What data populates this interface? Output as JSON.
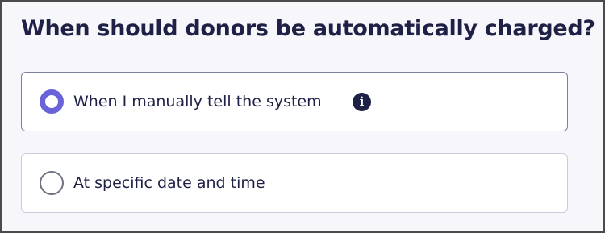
{
  "question": "When should donors be automatically charged?",
  "options": [
    {
      "label": "When I manually tell the system",
      "selected": true,
      "info_icon": "info-icon",
      "info_glyph": "i"
    },
    {
      "label": "At specific date and time",
      "selected": false
    }
  ],
  "colors": {
    "text": "#1e2046",
    "accent": "#6a62d8",
    "background": "#f7f7fb"
  }
}
